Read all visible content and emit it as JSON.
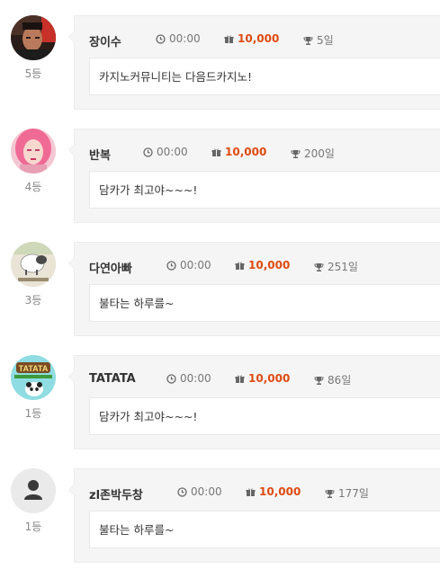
{
  "comments": [
    {
      "author": "장이수",
      "time": "00:00",
      "points": "10,000",
      "days": "5일",
      "rank": "5등",
      "message": "카지노커뮤니티는 다음드카지노!",
      "avatar_icon": "man-portrait-icon"
    },
    {
      "author": "반복",
      "time": "00:00",
      "points": "10,000",
      "days": "200일",
      "rank": "4등",
      "message": "담카가 최고야~~~!",
      "avatar_icon": "woman-portrait-icon"
    },
    {
      "author": "다연아빠",
      "time": "00:00",
      "points": "10,000",
      "days": "251일",
      "rank": "3등",
      "message": "불타는 하루를~",
      "avatar_icon": "cartoon-sheep-icon"
    },
    {
      "author": "TATATA",
      "time": "00:00",
      "points": "10,000",
      "days": "86일",
      "rank": "1등",
      "message": "담카가 최고야~~~!",
      "avatar_icon": "tatata-panda-logo-icon",
      "avatar_text": "TATATA"
    },
    {
      "author": "zl존박두창",
      "time": "00:00",
      "points": "10,000",
      "days": "177일",
      "rank": "1등",
      "message": "불타는 하루를~",
      "avatar_icon": "default-user-icon"
    }
  ],
  "colors": {
    "points_value": "#e04a10",
    "card_bg": "#f5f5f5",
    "message_bg": "#ffffff"
  }
}
